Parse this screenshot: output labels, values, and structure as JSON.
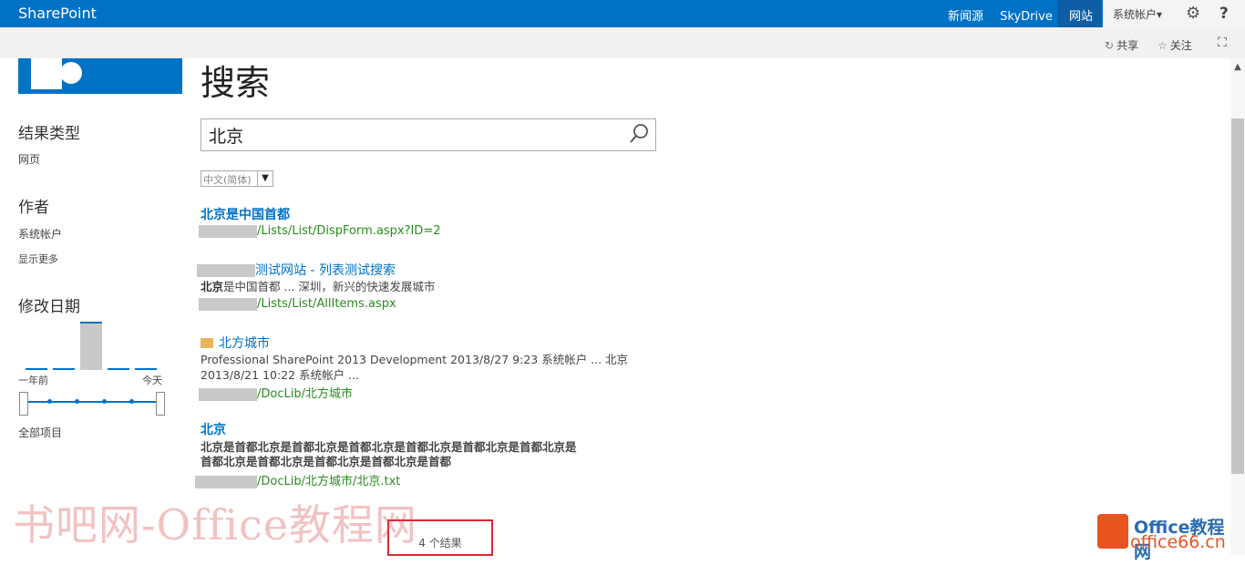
{
  "suitebar": {
    "brand": "SharePoint",
    "links": [
      "新闻源",
      "SkyDrive",
      "网站"
    ],
    "user": "系统帐户▾",
    "help": "?"
  },
  "actions": {
    "share": "共享",
    "follow": "关注"
  },
  "page_title": "搜索",
  "search": {
    "query": "北京",
    "language": "中文(简体)"
  },
  "refiners": {
    "result_type": {
      "heading": "结果类型",
      "items": [
        "网页"
      ]
    },
    "author": {
      "heading": "作者",
      "items": [
        "系统帐户"
      ],
      "more": "显示更多"
    },
    "modified": {
      "heading": "修改日期",
      "from": "一年前",
      "to": "今天",
      "all": "全部项目"
    }
  },
  "results": [
    {
      "title": "北京是中国首都",
      "url": "/Lists/List/DispForm.aspx?ID=2"
    },
    {
      "title": "测试网站 - 列表测试搜索",
      "desc": "北京是中国首都 ... 深圳，新兴的快速发展城市",
      "url": "/Lists/List/AllItems.aspx"
    },
    {
      "title": "北方城市",
      "desc1": "Professional SharePoint 2013 Development    2013/8/27 9:23 系统帐户 ... 北京",
      "desc2": "2013/8/21 10:22 系统帐户 ...",
      "url": "/DocLib/北方城市"
    },
    {
      "title": "北京",
      "desc1": "北京是首都北京是首都北京是首都北京是首都北京是首都北京是首都北京是",
      "desc2": "首都北京是首都北京是首都北京是首都北京是首都",
      "url": "/DocLib/北方城市/北京.txt"
    }
  ],
  "result_count": "4 个结果",
  "watermark": {
    "left": "书吧网-Office教程网",
    "right_top": "Office教程网",
    "right_bottom": "office66.cn"
  },
  "colors": {
    "suitebar": "#0072c6",
    "link": "#0072c6",
    "url": "#2a8b1e",
    "highlight_box": "#d8282f"
  }
}
